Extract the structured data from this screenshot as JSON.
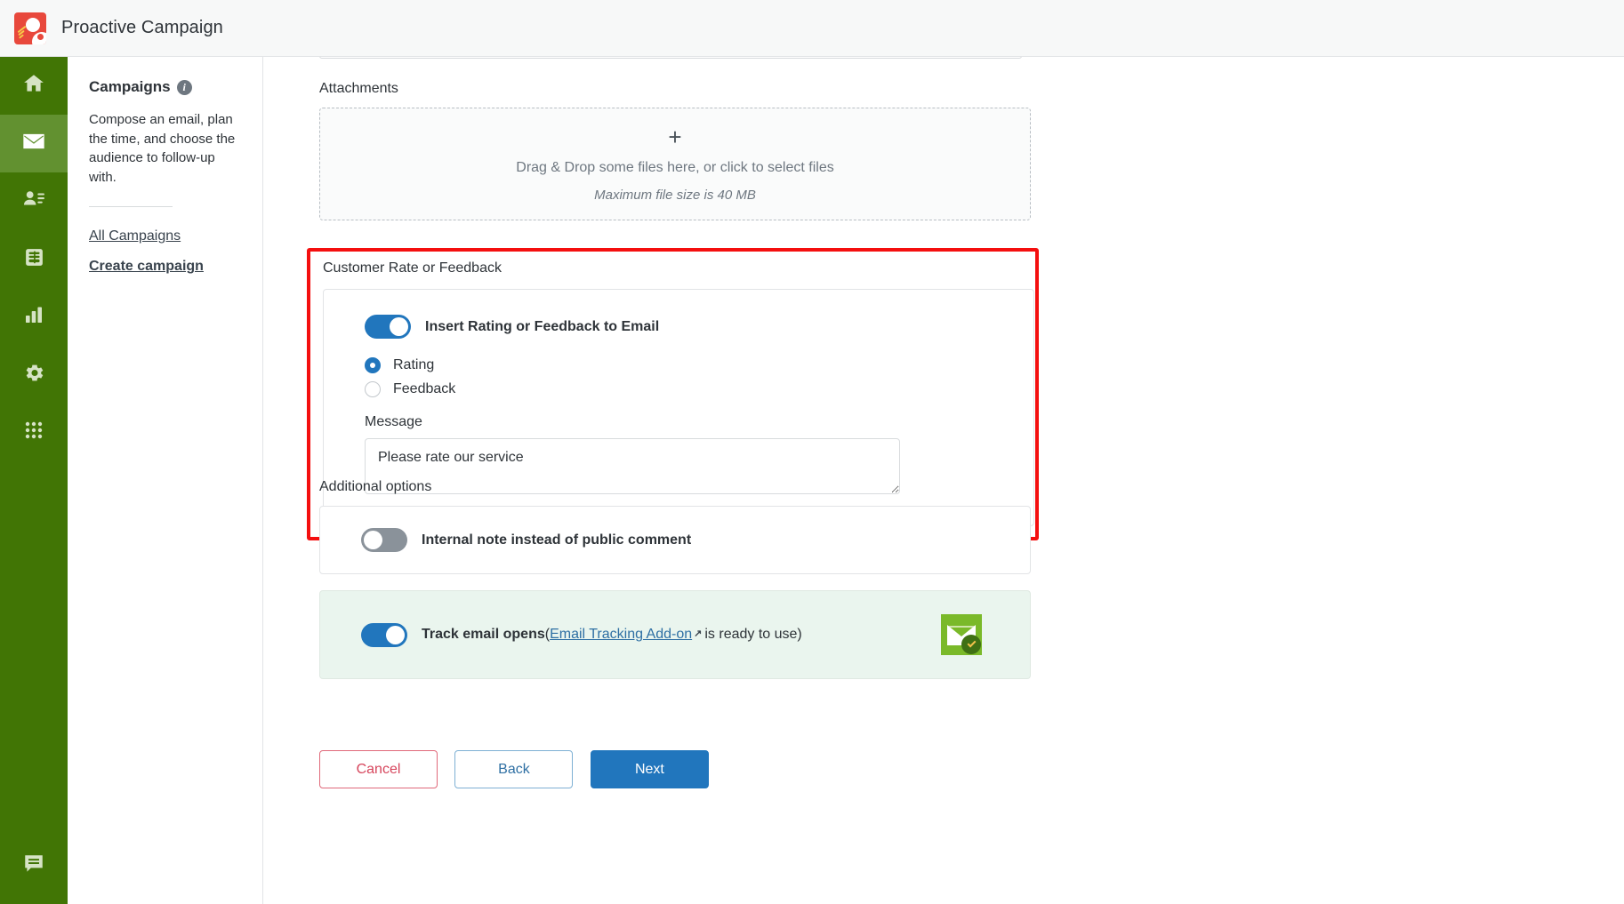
{
  "app": {
    "title": "Proactive Campaign",
    "logo_icon": "sun-cloud-logo-icon"
  },
  "rail": {
    "items": [
      {
        "name": "home",
        "icon": "home-icon",
        "active": false
      },
      {
        "name": "campaigns",
        "icon": "mail-icon",
        "active": true
      },
      {
        "name": "contacts",
        "icon": "contacts-icon",
        "active": false
      },
      {
        "name": "database",
        "icon": "database-icon",
        "active": false
      },
      {
        "name": "reports",
        "icon": "bar-chart-icon",
        "active": false
      },
      {
        "name": "settings",
        "icon": "gear-icon",
        "active": false
      },
      {
        "name": "apps",
        "icon": "grid-apps-icon",
        "active": false
      }
    ],
    "bottom_item": {
      "name": "chat",
      "icon": "chat-bubble-icon"
    }
  },
  "panel": {
    "title": "Campaigns",
    "info_glyph": "i",
    "description": "Compose an email, plan the time, and choose the audience to follow-up with.",
    "links": [
      {
        "label": "All Campaigns",
        "bold": false
      },
      {
        "label": "Create campaign",
        "bold": true
      }
    ]
  },
  "attachments": {
    "label": "Attachments",
    "plus_glyph": "+",
    "dropzone_text": "Drag & Drop some files here, or click to select files",
    "max_size_text": "Maximum file size is 40 MB"
  },
  "rate_feedback": {
    "section_label": "Customer Rate or Feedback",
    "toggle_label": "Insert Rating or Feedback to Email",
    "toggle_on": true,
    "options": [
      {
        "label": "Rating",
        "selected": true
      },
      {
        "label": "Feedback",
        "selected": false
      }
    ],
    "message_label": "Message",
    "message_value": "Please rate our service",
    "message_placeholder": "Please rate our service",
    "highlight_color": "#f40f0f"
  },
  "additional_options": {
    "section_label": "Additional options",
    "internal_note": {
      "label": "Internal note instead of public comment",
      "toggle_on": false
    },
    "track_email": {
      "label_prefix": "Track email opens",
      "paren_open": "(",
      "link_text": "Email Tracking Add-on",
      "ext_glyph": "↗",
      "label_suffix": "is ready to use)",
      "toggle_on": true,
      "badge_icon": "email-tracking-addon-icon"
    }
  },
  "footer": {
    "cancel_label": "Cancel",
    "back_label": "Back",
    "next_label": "Next"
  },
  "colors": {
    "rail_green": "#417505",
    "rail_active_green": "#629130",
    "accent_blue": "#2176bd",
    "highlight_red": "#f40f0f",
    "logo_red": "#e8483c",
    "badge_green": "#7ab929"
  }
}
